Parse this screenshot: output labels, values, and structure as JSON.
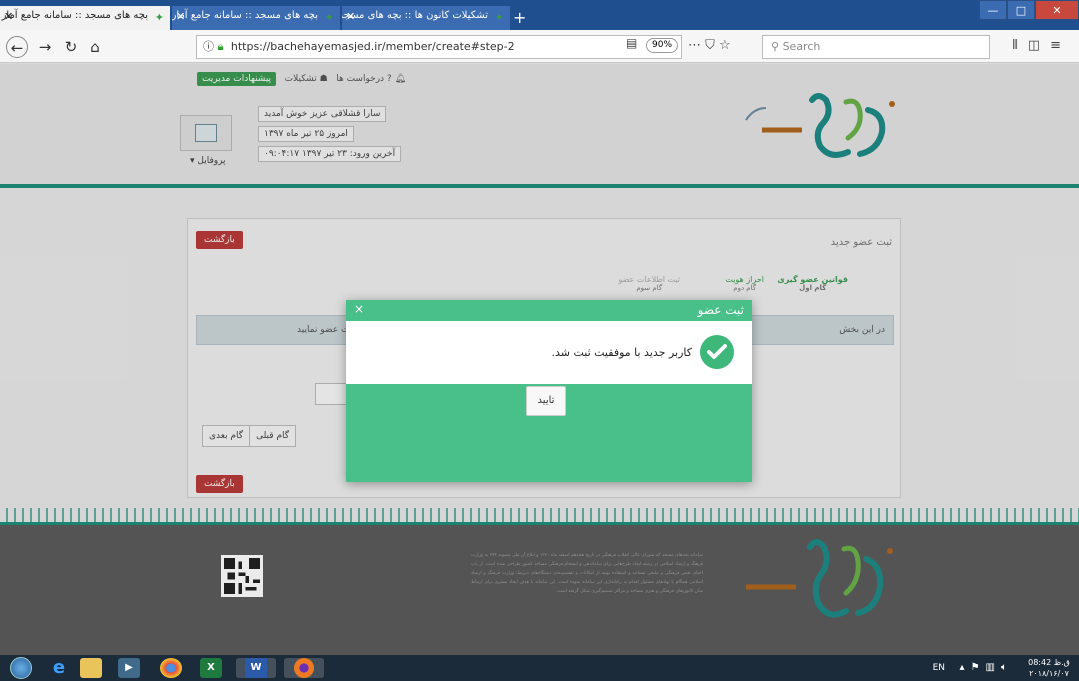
{
  "browser": {
    "tabs": [
      {
        "title": "بچه های مسجد :: سامانه جامع آمار",
        "active": true
      },
      {
        "title": "بچه های مسجد :: سامانه جامع آمار",
        "active": false
      },
      {
        "title": "تشکیلات کانون ها :: بچه های مسجد",
        "active": false
      }
    ],
    "new_tab_icon": "plus-icon",
    "url": "https://bachehayemasjed.ir/member/create#step-2",
    "zoom": "90%",
    "search_placeholder": "Search"
  },
  "header": {
    "links": {
      "suggestions": "پیشنهادات مدیریت",
      "units": "تشکیلات",
      "requests": "درخواست ها"
    },
    "welcome": "سارا قشلاقی عزیز خوش آمدید",
    "today": "امروز ۲۵ تیر ماه ۱۳۹۷",
    "last_login": "آخرین ورود: ۲۳ تیر ۱۳۹۷ ۰۹:۰۴:۱۷",
    "profile": "پروفایل ▾"
  },
  "card": {
    "title": "ثبت عضو جدید",
    "back_label": "بازگشت",
    "steps": [
      {
        "label": "قوانین عضو گیری",
        "sub": "گام اول"
      },
      {
        "label": "احراز هویت",
        "sub": "گام دوم"
      },
      {
        "label": "ثبت اطلاعات عضو",
        "sub": "گام سوم"
      }
    ],
    "alert_right": "در این بخش",
    "alert_left": "اطلاعات عضو نمایید",
    "prev_label": "گام قبلی",
    "next_label": "گام بعدی"
  },
  "modal": {
    "title": "ثبت عضو",
    "close": "×",
    "message": "کاربر جدید با موفقیت ثبت شد.",
    "ok_label": "تایید"
  },
  "footer": {
    "about": "سامانه بچه‌های مسجد که شورای عالی انقلاب فرهنگی در تاریخ هجدهم اسفند ماه ۱۳۷۰ و ابلاغ آن طی مصوبه ۲۷۴ به وزارت فرهنگ و ارشاد اسلامی در زمینه ایجاد طرح‌هایی برای ساماندهی و انسجام فرهنگی مساجد کشور طراحی شده است. از باب احیای نقش فرهنگی و تبلیغی مساجد و استفاده بهینه از امکانات و تقسیم‌بندی دستگاه‌های ذیربط، وزارت فرهنگ و ارشاد اسلامی همگام با نهادهای مسئول اقدام به راه‌اندازی این سامانه نموده است. این سامانه با هدف ایجاد بستری برای ارتباط میان کانون‌های فرهنگی و هنری مساجد و مراکز تصمیم‌گیری شکل گرفته است."
  },
  "taskbar": {
    "lang": "EN",
    "time": "08:42 ق.ظ",
    "date": "۲۰۱۸/۱۶/۰۷"
  },
  "colors": {
    "modal_green": "#49c08a",
    "check_green": "#3eb77a",
    "danger_red": "#b93a3a",
    "teal": "#1f8f7a"
  }
}
